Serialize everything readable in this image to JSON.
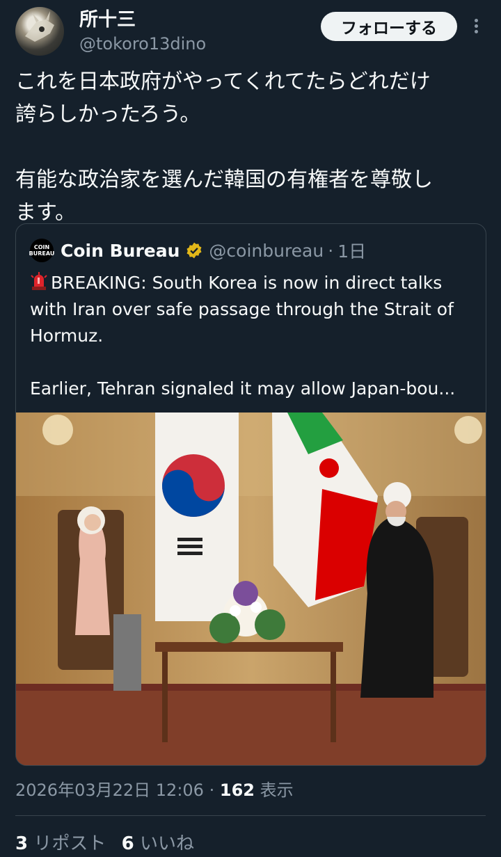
{
  "author": {
    "display_name": "所十三",
    "handle": "@tokoro13dino",
    "avatar_icon": "dinosaur-skull-avatar"
  },
  "follow_label": "フォローする",
  "more_icon": "more-vertical-icon",
  "tweet_text": "これを日本政府がやってくれてたらどれだけ\n誇らしかったろう。\n\n有能な政治家を選んだ韓国の有権者を尊敬し\nます。",
  "quote": {
    "logo_text_top": "COIN",
    "logo_text_bottom": "BUREAU",
    "name": "Coin Bureau",
    "verified_icon": "gold-verified-badge-icon",
    "handle": "@coinbureau",
    "sep": "·",
    "time": "1日",
    "siren_icon": "police-siren-emoji-icon",
    "body": "BREAKING: South Korea is now in direct talks\nwith Iran over safe passage through the Strait of\nHormuz.\n\nEarlier, Tehran signaled it may allow Japan-bou...",
    "photo": "leaders-meeting-photo-korea-iran-flags"
  },
  "meta": {
    "datetime": "2026年03月22日 12:06",
    "sep": "·",
    "views": "162",
    "views_label": "表示"
  },
  "stats": {
    "reposts": "3",
    "reposts_label": "リポスト",
    "likes": "6",
    "likes_label": "いいね"
  },
  "colors": {
    "background": "#15202b",
    "text": "#f7f9f9",
    "secondary": "#8b98a5",
    "border": "#38444d"
  }
}
